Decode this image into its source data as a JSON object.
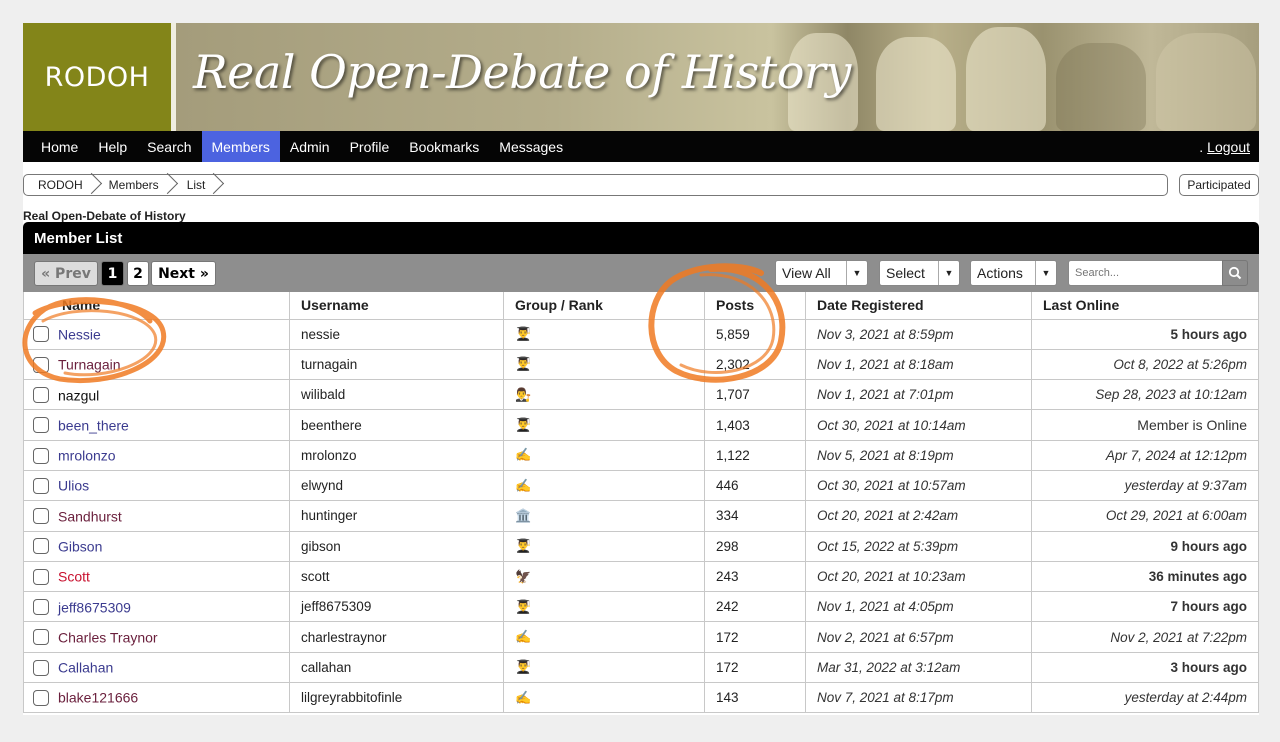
{
  "brand": {
    "logo": "RODOH",
    "title": "Real Open-Debate of History"
  },
  "nav": {
    "items": [
      "Home",
      "Help",
      "Search",
      "Members",
      "Admin",
      "Profile",
      "Bookmarks",
      "Messages"
    ],
    "active": "Members",
    "logout_prefix": ".",
    "logout": "Logout",
    "active_color": "#4c63e0"
  },
  "breadcrumb": [
    "RODOH",
    "Members",
    "List"
  ],
  "participated": "Participated",
  "site_label": "Real Open-Debate of History",
  "panel": {
    "title": "Member List",
    "pagination": {
      "prev": "« Prev",
      "pages": [
        "1",
        "2"
      ],
      "current": "1",
      "next": "Next »"
    },
    "dropdowns": {
      "view": "View All",
      "select": "Select",
      "actions": "Actions"
    },
    "search_placeholder": "Search..."
  },
  "table": {
    "headers": [
      "Name",
      "Username",
      "Group / Rank",
      "Posts",
      "Date Registered",
      "Last Online"
    ],
    "rows": [
      {
        "name": "Nessie",
        "username": "nessie",
        "rank_icon": "scholar-icon",
        "rank_glyph": "👨‍🎓",
        "posts": "5,859",
        "registered": "Nov 3, 2021 at 8:59pm",
        "last_online": "5 hours ago",
        "lo_style": "bold",
        "name_color": "#3b3b8f"
      },
      {
        "name": "Turnagain",
        "username": "turnagain",
        "rank_icon": "scholar-icon",
        "rank_glyph": "👨‍🎓",
        "posts": "2,302",
        "registered": "Nov 1, 2021 at 8:18am",
        "last_online": "Oct 8, 2022 at 5:26pm",
        "lo_style": "italic",
        "name_color": "#6a1f3c"
      },
      {
        "name": "nazgul",
        "username": "wilibald",
        "rank_icon": "judge-icon",
        "rank_glyph": "👨‍⚖️",
        "posts": "1,707",
        "registered": "Nov 1, 2021 at 7:01pm",
        "last_online": "Sep 28, 2023 at 10:12am",
        "lo_style": "italic",
        "name_color": "#111111"
      },
      {
        "name": "been_there",
        "username": "beenthere",
        "rank_icon": "scholar-icon",
        "rank_glyph": "👨‍🎓",
        "posts": "1,403",
        "registered": "Oct 30, 2021 at 10:14am",
        "last_online": "Member is Online",
        "lo_style": "plain",
        "name_color": "#3b3b8f"
      },
      {
        "name": "mrolonzo",
        "username": "mrolonzo",
        "rank_icon": "writing-hand-icon",
        "rank_glyph": "✍️",
        "posts": "1,122",
        "registered": "Nov 5, 2021 at 8:19pm",
        "last_online": "Apr 7, 2024 at 12:12pm",
        "lo_style": "italic",
        "name_color": "#3b3b8f"
      },
      {
        "name": "Ulios",
        "username": "elwynd",
        "rank_icon": "writing-hand-icon",
        "rank_glyph": "✍️",
        "posts": "446",
        "registered": "Oct 30, 2021 at 10:57am",
        "last_online": "yesterday at 9:37am",
        "lo_style": "italic",
        "name_color": "#3b3b8f"
      },
      {
        "name": "Sandhurst",
        "username": "huntinger",
        "rank_icon": "classical-building-icon",
        "rank_glyph": "🏛️",
        "posts": "334",
        "registered": "Oct 20, 2021 at 2:42am",
        "last_online": "Oct 29, 2021 at 6:00am",
        "lo_style": "italic",
        "name_color": "#6a1f3c"
      },
      {
        "name": "Gibson",
        "username": "gibson",
        "rank_icon": "scholar-icon",
        "rank_glyph": "👨‍🎓",
        "posts": "298",
        "registered": "Oct 15, 2022 at 5:39pm",
        "last_online": "9 hours ago",
        "lo_style": "bold",
        "name_color": "#3b3b8f"
      },
      {
        "name": "Scott",
        "username": "scott",
        "rank_icon": "eagle-icon",
        "rank_glyph": "🦅",
        "posts": "243",
        "registered": "Oct 20, 2021 at 10:23am",
        "last_online": "36 minutes ago",
        "lo_style": "bold",
        "name_color": "#c8102e"
      },
      {
        "name": "jeff8675309",
        "username": "jeff8675309",
        "rank_icon": "scholar-icon",
        "rank_glyph": "👨‍🎓",
        "posts": "242",
        "registered": "Nov 1, 2021 at 4:05pm",
        "last_online": "7 hours ago",
        "lo_style": "bold",
        "name_color": "#3b3b8f"
      },
      {
        "name": "Charles Traynor",
        "username": "charlestraynor",
        "rank_icon": "writing-hand-icon",
        "rank_glyph": "✍️",
        "posts": "172",
        "registered": "Nov 2, 2021 at 6:57pm",
        "last_online": "Nov 2, 2021 at 7:22pm",
        "lo_style": "italic",
        "name_color": "#6a1f3c"
      },
      {
        "name": "Callahan",
        "username": "callahan",
        "rank_icon": "scholar-icon",
        "rank_glyph": "👨‍🎓",
        "posts": "172",
        "registered": "Mar 31, 2022 at 3:12am",
        "last_online": "3 hours ago",
        "lo_style": "bold",
        "name_color": "#3b3b8f"
      },
      {
        "name": "blake121666",
        "username": "lilgreyrabbitofinle",
        "rank_icon": "writing-hand-icon",
        "rank_glyph": "✍️",
        "posts": "143",
        "registered": "Nov 7, 2021 at 8:17pm",
        "last_online": "yesterday at 2:44pm",
        "lo_style": "italic",
        "name_color": "#6a1f3c"
      }
    ]
  },
  "annotation_color": "#f07a22"
}
